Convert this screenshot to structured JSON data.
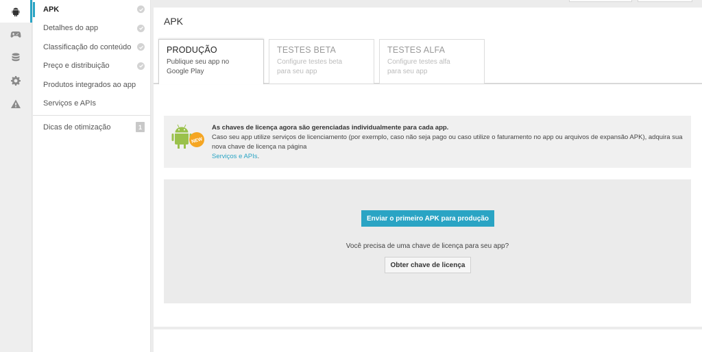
{
  "rail": {
    "items": [
      {
        "icon": "android-icon",
        "active": true
      },
      {
        "icon": "gamepad-icon",
        "active": false
      },
      {
        "icon": "database-icon",
        "active": false
      },
      {
        "icon": "gear-icon",
        "active": false
      },
      {
        "icon": "warning-icon",
        "active": false
      }
    ]
  },
  "nav": {
    "items": [
      {
        "label": "APK",
        "checked": true
      },
      {
        "label": "Detalhes do app",
        "checked": true
      },
      {
        "label": "Classificação do conteúdo",
        "checked": true
      },
      {
        "label": "Preço e distribuição",
        "checked": true
      },
      {
        "label": "Produtos integrados ao app",
        "checked": false
      },
      {
        "label": "Serviços e APIs",
        "checked": false
      }
    ],
    "tips": {
      "label": "Dicas de otimização",
      "count": "1"
    }
  },
  "main": {
    "title": "APK",
    "tabs": [
      {
        "title": "PRODUÇÃO",
        "desc": "Publique seu app no Google Play"
      },
      {
        "title": "TESTES BETA",
        "desc": "Configure testes beta para seu app"
      },
      {
        "title": "TESTES ALFA",
        "desc": "Configure testes alfa para seu app"
      }
    ],
    "notice": {
      "icon_badge": "NEW",
      "title": "As chaves de licença agora são gerenciadas individualmente para cada app.",
      "body": "Caso seu app utilize serviços de licenciamento (por exemplo, caso não seja pago ou caso utilize o faturamento no app ou arquivos de expansão APK), adquira sua nova chave de licença na página",
      "link": "Serviços e APIs",
      "link_suffix": "."
    },
    "upload": {
      "primary_button": "Enviar o primeiro APK para produção",
      "question": "Você precisa de uma chave de licença para seu app?",
      "secondary_button": "Obter chave de licença"
    }
  },
  "colors": {
    "accent": "#2aa4c4",
    "android_green": "#9ac14b",
    "badge_orange": "#f5a623"
  }
}
